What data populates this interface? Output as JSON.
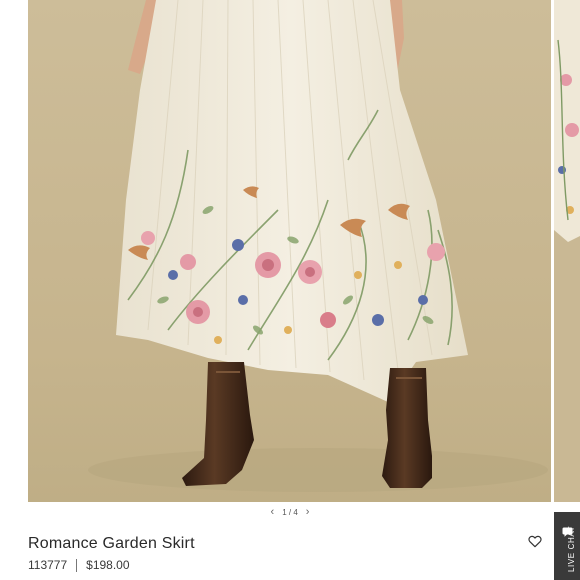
{
  "gallery": {
    "current": "1",
    "separator": "/",
    "total": "4",
    "prev_icon": "chevron-left-icon",
    "next_icon": "chevron-right-icon"
  },
  "product": {
    "name": "Romance Garden Skirt",
    "sku": "113777",
    "price": "$198.00"
  },
  "wishlist": {
    "icon": "heart-outline-icon"
  },
  "live_chat": {
    "label": "LIVE CHAT",
    "icon": "chat-bubble-icon"
  },
  "colors": {
    "backdrop": "#c9b894",
    "skirt": "#f1ebdc",
    "boots": "#3d2617",
    "chat_bg": "#3a3a3a"
  }
}
